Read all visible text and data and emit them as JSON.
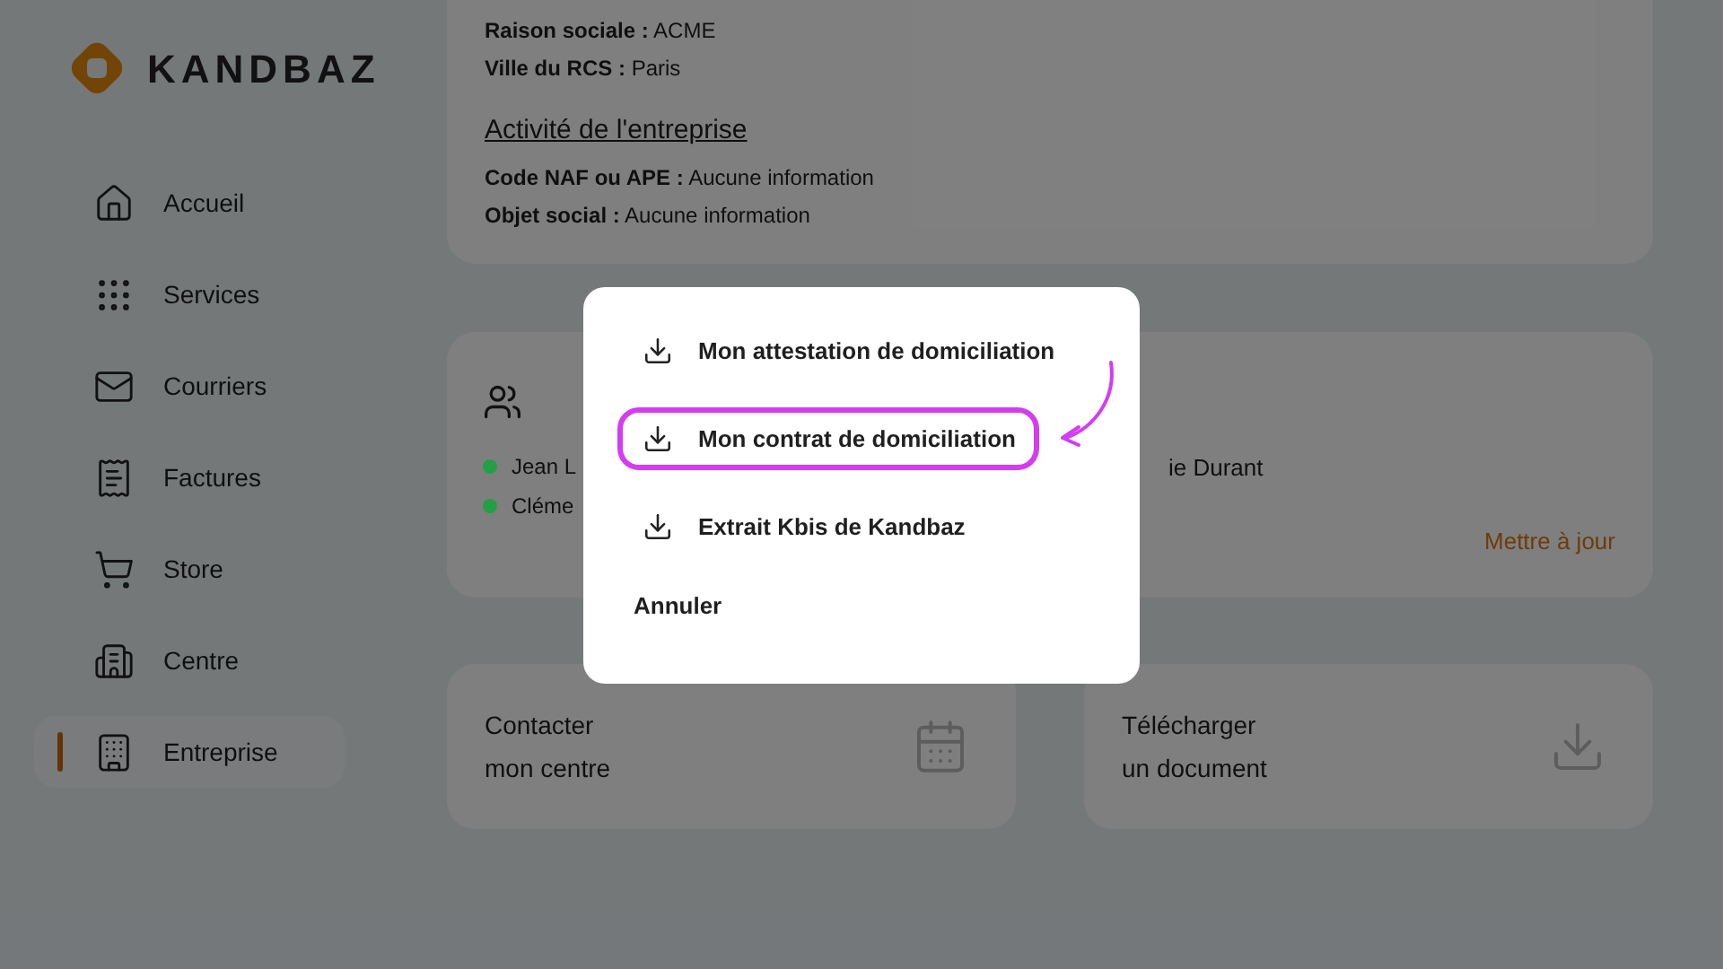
{
  "brand": {
    "name": "KANDBAZ"
  },
  "sidebar": {
    "items": [
      {
        "label": "Accueil",
        "kind": "home",
        "selected": false
      },
      {
        "label": "Services",
        "kind": "grid",
        "selected": false
      },
      {
        "label": "Courriers",
        "kind": "mail",
        "selected": false
      },
      {
        "label": "Factures",
        "kind": "receipt",
        "selected": false
      },
      {
        "label": "Store",
        "kind": "cart",
        "selected": false
      },
      {
        "label": "Centre",
        "kind": "building",
        "selected": false
      },
      {
        "label": "Entreprise",
        "kind": "company",
        "selected": true
      }
    ]
  },
  "company_card": {
    "fields": [
      {
        "label": "Raison sociale :",
        "value": "ACME"
      },
      {
        "label": "Ville du RCS :",
        "value": "Paris"
      }
    ],
    "section_title": "Activité de l'entreprise",
    "activity_fields": [
      {
        "label": "Code NAF ou APE :",
        "value": "Aucune information"
      },
      {
        "label": "Objet social :",
        "value": "Aucune information"
      }
    ]
  },
  "people_card": {
    "left_names": [
      {
        "name": "Jean L",
        "color": "#22a046"
      },
      {
        "name": "Cléme",
        "color": "#22a046"
      }
    ],
    "right_names": [
      "ie Durant"
    ],
    "update_link": "Mettre à jour"
  },
  "action_cards": [
    {
      "lines": [
        "Contacter",
        "mon centre"
      ],
      "kind": "calendar"
    },
    {
      "lines": [
        "Télécharger",
        "un document"
      ],
      "kind": "download"
    }
  ],
  "modal": {
    "options": [
      {
        "label": "Mon attestation de domiciliation",
        "highlighted": false
      },
      {
        "label": "Mon contrat de domiciliation",
        "highlighted": true
      },
      {
        "label": "Extrait Kbis de Kandbaz",
        "highlighted": false
      }
    ],
    "cancel": "Annuler"
  }
}
